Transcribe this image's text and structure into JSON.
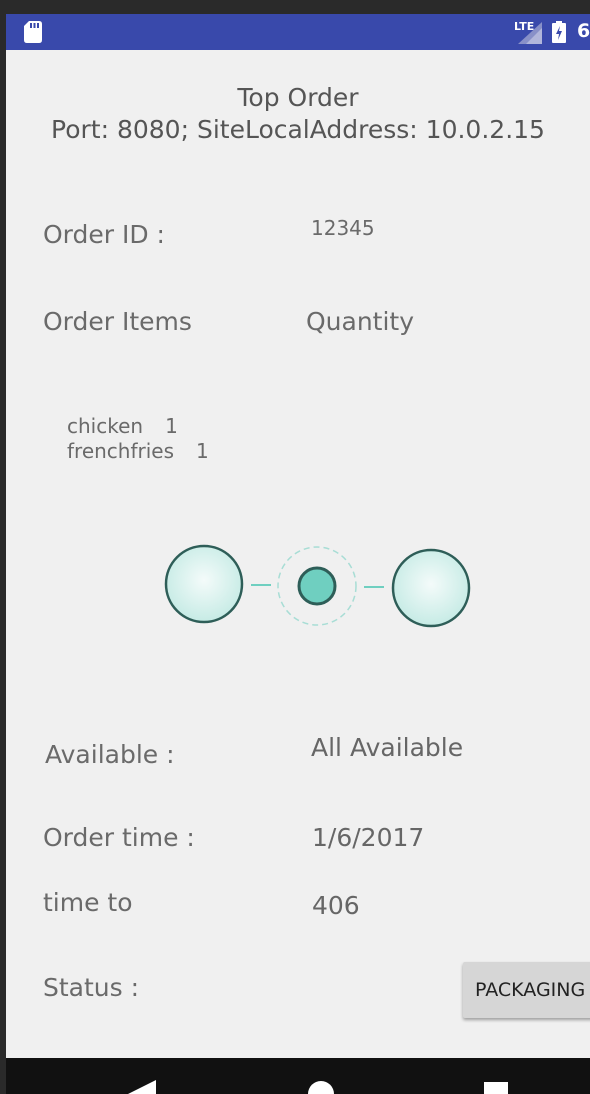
{
  "status_bar": {
    "network_label": "LTE",
    "battery_text": "6",
    "bar_color": "#3949ab",
    "icons": [
      "sd-card-icon",
      "signal-icon",
      "battery-charging-icon"
    ]
  },
  "header": {
    "title": "Top Order",
    "subtitle": "Port: 8080; SiteLocalAddress: 10.0.2.15"
  },
  "order": {
    "id_label": "Order ID :",
    "id_value": "12345",
    "items_header": "Order Items",
    "quantity_header": "Quantity",
    "items": [
      {
        "name": "chicken",
        "qty": "1"
      },
      {
        "name": "frenchfries",
        "qty": "1"
      }
    ],
    "available_label": "Available :",
    "available_value": "All Available",
    "order_time_label": "Order time :",
    "order_time_value": "1/6/2017",
    "time_to_label": "time to",
    "time_to_value": "406",
    "status_label": "Status :",
    "status_button": "PACKAGING"
  },
  "progress_indicator": {
    "icon": "step-progress-loader",
    "accent_color": "#6fcfc0",
    "border_color": "#2e5e58"
  },
  "nav_bar": {
    "icons": [
      "back-icon",
      "home-icon",
      "recents-icon"
    ]
  }
}
